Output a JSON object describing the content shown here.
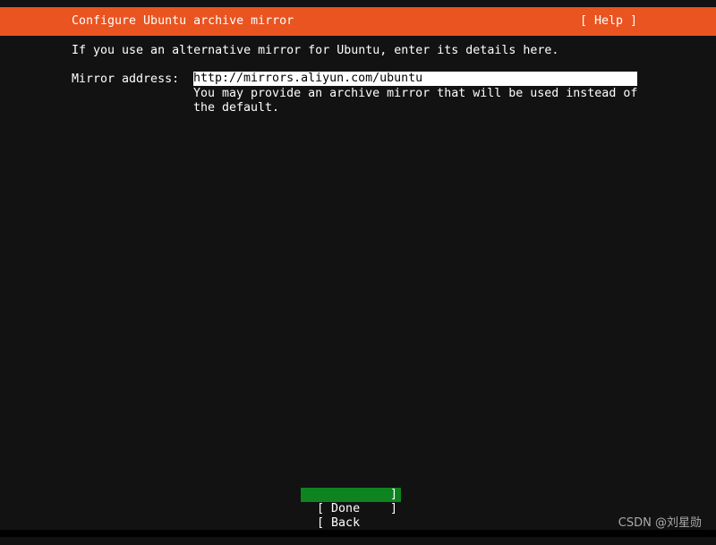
{
  "header": {
    "title": "Configure Ubuntu archive mirror",
    "help_label": "[ Help ]"
  },
  "intro": "If you use an alternative mirror for Ubuntu, enter its details here.",
  "mirror": {
    "label": "Mirror address:",
    "value": "http://mirrors.aliyun.com/ubuntu",
    "help_line1": "You may provide an archive mirror that will be used instead of",
    "help_line2": "the default."
  },
  "buttons": {
    "done": "Done",
    "back": "Back",
    "open_bracket": "[",
    "close_bracket": "]"
  },
  "watermark": "CSDN @刘星勋",
  "colors": {
    "accent": "#E95420",
    "selected": "#0E8420",
    "background": "#121212"
  }
}
